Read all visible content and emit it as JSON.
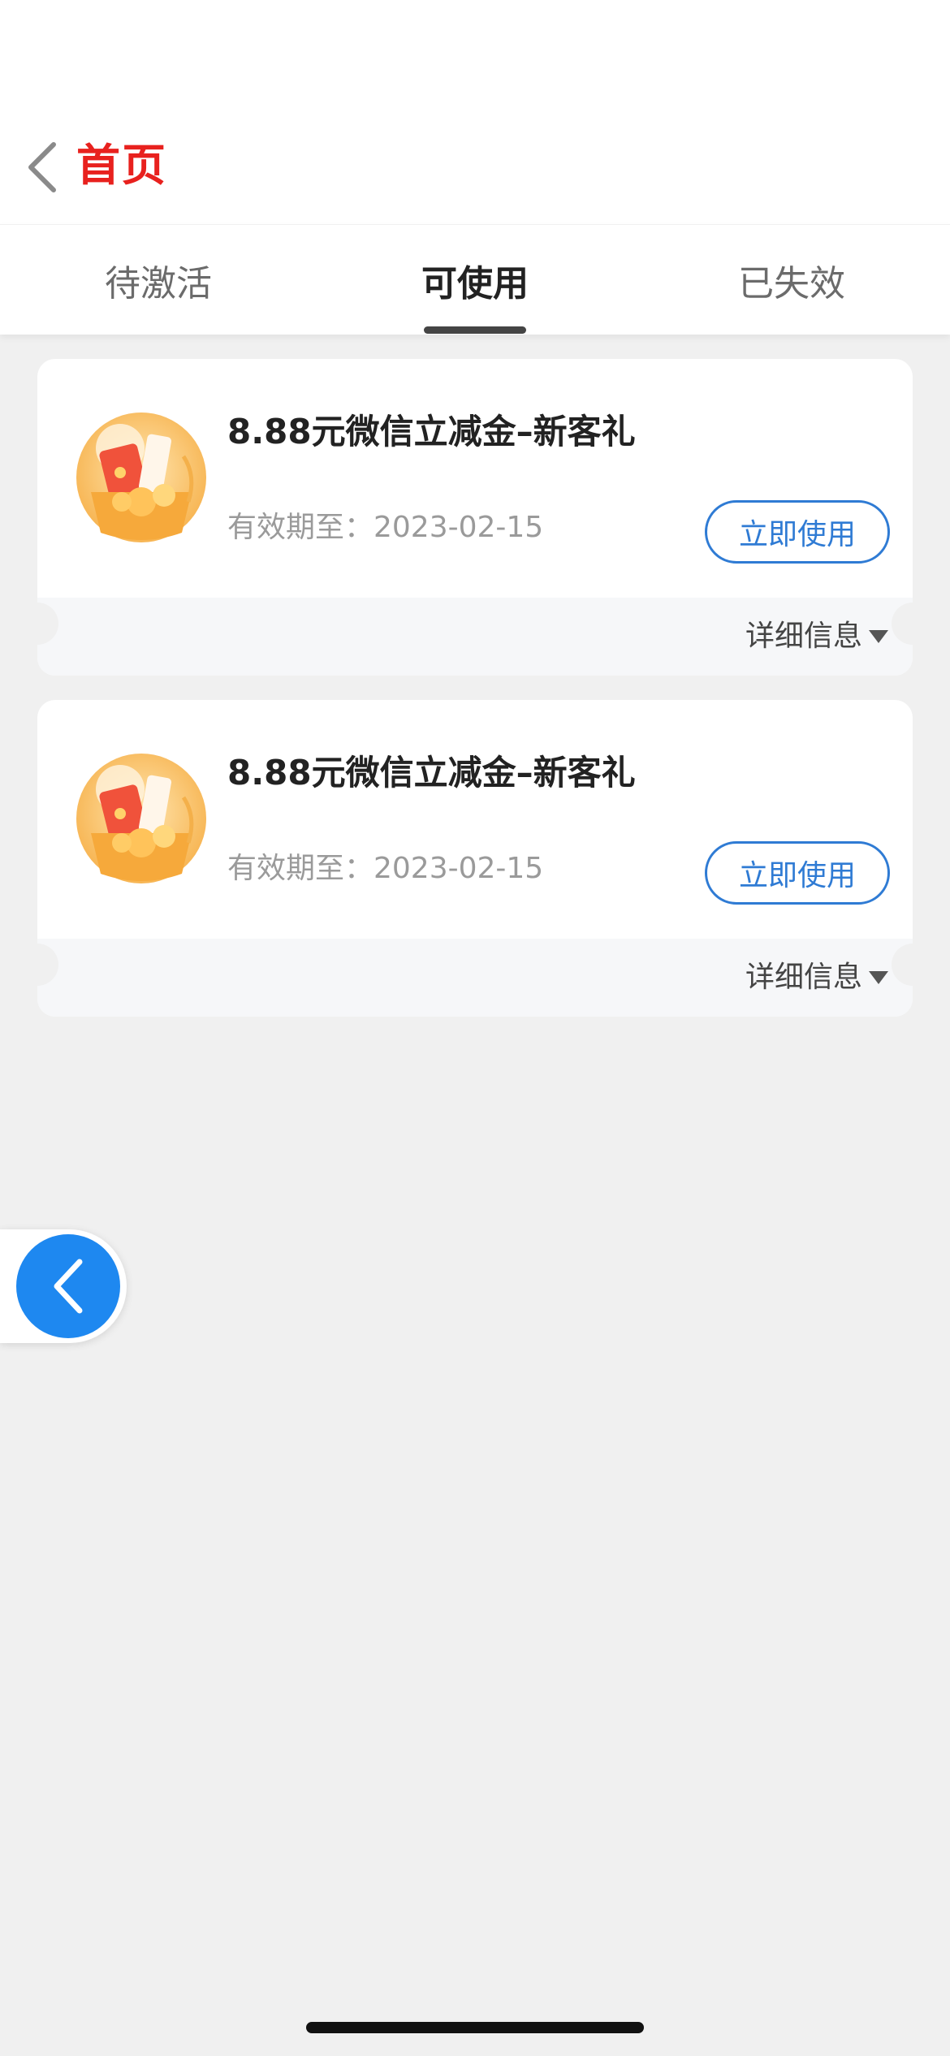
{
  "header": {
    "title": "首页"
  },
  "tabs": [
    {
      "label": "待激活",
      "active": false
    },
    {
      "label": "可使用",
      "active": true
    },
    {
      "label": "已失效",
      "active": false
    }
  ],
  "coupons": [
    {
      "title": "8.88元微信立减金–新客礼",
      "expiry": "有效期至：2023-02-15",
      "use_label": "立即使用",
      "detail_label": "详细信息",
      "icon": "red-envelope-gift-icon"
    },
    {
      "title": "8.88元微信立减金–新客礼",
      "expiry": "有效期至：2023-02-15",
      "use_label": "立即使用",
      "detail_label": "详细信息",
      "icon": "red-envelope-gift-icon"
    }
  ],
  "colors": {
    "title_red": "#e8211e",
    "accent_blue": "#2f7bd4",
    "float_blue": "#1e88f0",
    "background": "#f0f0f0"
  }
}
